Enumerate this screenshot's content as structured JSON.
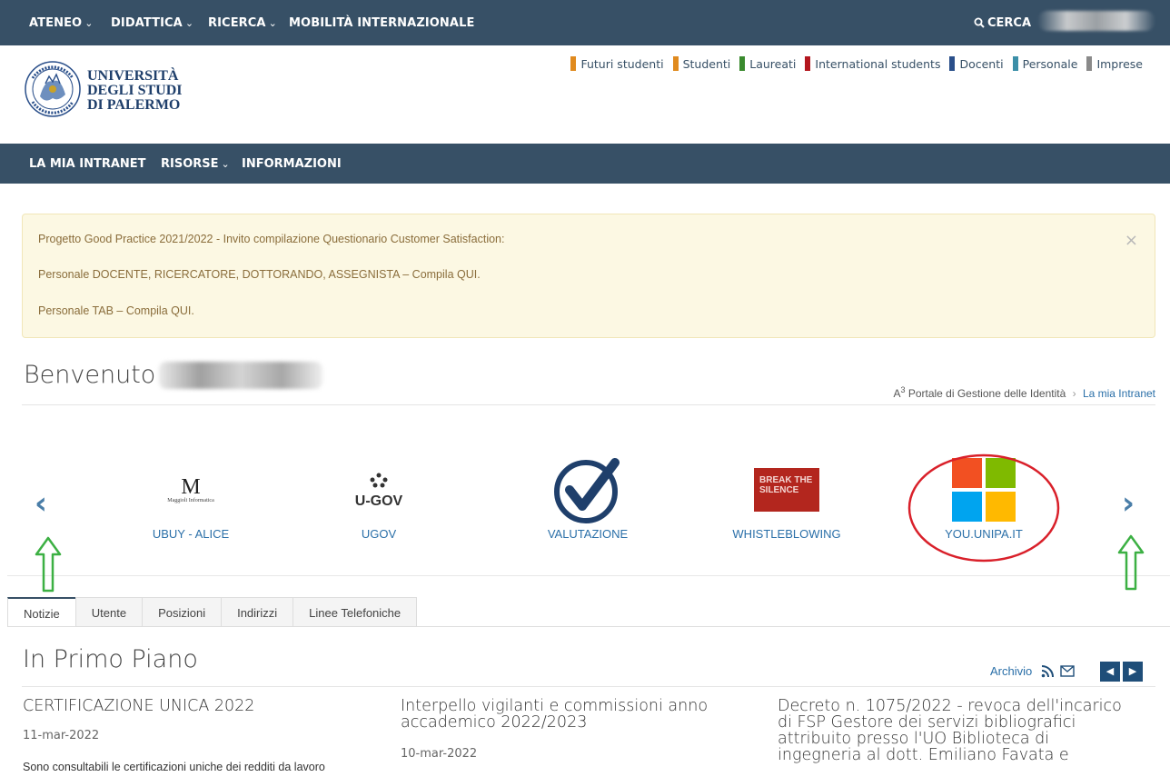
{
  "topnav": {
    "items": [
      {
        "label": "ATENEO",
        "has_dropdown": true
      },
      {
        "label": "DIDATTICA",
        "has_dropdown": true
      },
      {
        "label": "RICERCA",
        "has_dropdown": true
      },
      {
        "label": "MOBILITÀ INTERNAZIONALE",
        "has_dropdown": false
      }
    ],
    "search_label": "CERCA"
  },
  "header": {
    "university_line1": "UNIVERSITÀ",
    "university_line2": "DEGLI STUDI",
    "university_line3": "DI PALERMO",
    "audience_links": [
      {
        "label": "Futuri studenti",
        "color": "#e08a1e"
      },
      {
        "label": "Studenti",
        "color": "#e08a1e"
      },
      {
        "label": "Laureati",
        "color": "#3a8a2e"
      },
      {
        "label": "International students",
        "color": "#b3161e"
      },
      {
        "label": "Docenti",
        "color": "#2a4f8a"
      },
      {
        "label": "Personale",
        "color": "#3c8fa8"
      },
      {
        "label": "Imprese",
        "color": "#8a8a8a"
      }
    ]
  },
  "subnav": {
    "items": [
      {
        "label": "LA MIA INTRANET",
        "has_dropdown": false
      },
      {
        "label": "RISORSE",
        "has_dropdown": true
      },
      {
        "label": "INFORMAZIONI",
        "has_dropdown": false
      }
    ]
  },
  "alert": {
    "line1": "Progetto Good Practice 2021/2022 - Invito compilazione Questionario Customer Satisfaction:",
    "line2": "Personale DOCENTE, RICERCATORE, DOTTORANDO, ASSEGNISTA – Compila QUI.",
    "line3": "Personale TAB – Compila QUI.",
    "close": "×"
  },
  "welcome": {
    "prefix": "Benvenuto",
    "breadcrumb_portal": "Portale di Gestione delle Identità",
    "breadcrumb_sep": "›",
    "breadcrumb_current": "La mia Intranet"
  },
  "carousel": {
    "prev": "‹",
    "next": "›",
    "apps": [
      {
        "label": "UBUY - ALICE",
        "logo_text": "Maggioli Informatica"
      },
      {
        "label": "UGOV",
        "logo_text": "U-GOV"
      },
      {
        "label": "VALUTAZIONE"
      },
      {
        "label": "WHISTLEBLOWING",
        "logo_text": "BREAK THE SILENCE"
      },
      {
        "label": "YOU.UNIPA.IT"
      }
    ]
  },
  "tabs": [
    {
      "label": "Notizie",
      "active": true
    },
    {
      "label": "Utente",
      "active": false
    },
    {
      "label": "Posizioni",
      "active": false
    },
    {
      "label": "Indirizzi",
      "active": false
    },
    {
      "label": "Linee Telefoniche",
      "active": false
    }
  ],
  "news": {
    "title": "In Primo Piano",
    "archive_label": "Archivio",
    "items": [
      {
        "title": "CERTIFICAZIONE UNICA 2022",
        "date": "11-mar-2022",
        "snippet": "Sono consultabili le certificazioni uniche dei redditi da lavoro"
      },
      {
        "title_line1": "Interpello vigilanti e commissioni anno",
        "title_line2": "accademico 2022/2023",
        "date": "10-mar-2022"
      },
      {
        "title_line1": "Decreto n. 1075/2022 - revoca dell'incarico",
        "title_line2": "di FSP Gestore dei servizi bibliografici",
        "title_line3": "attribuito presso l'UO Biblioteca di",
        "title_line4": "ingegneria al dott. Emiliano Favata e"
      }
    ]
  }
}
